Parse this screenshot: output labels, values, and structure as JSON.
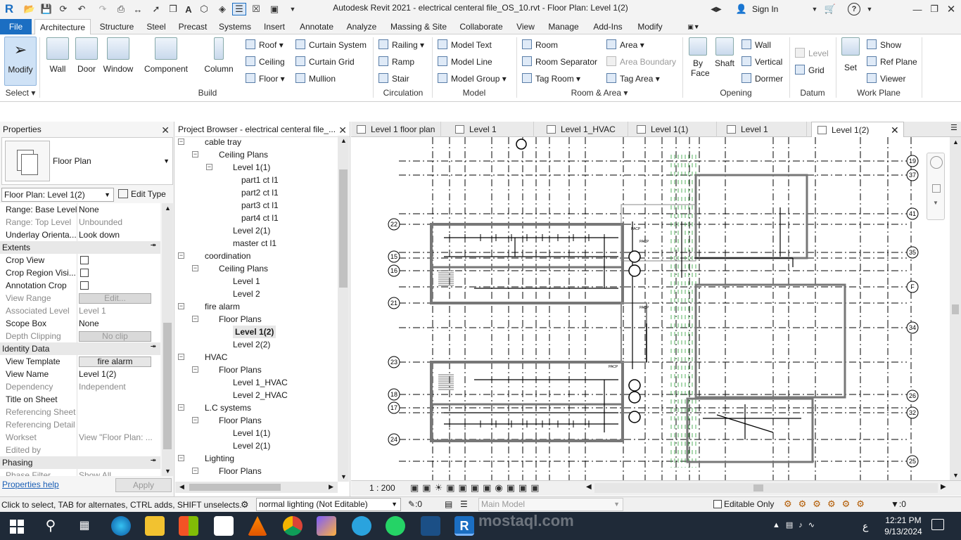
{
  "titlebar": {
    "title": "Autodesk Revit 2021 - electrical centeral file_OS_10.rvt - Floor Plan: Level 1(2)",
    "app_logo": "R",
    "sign_in": "Sign In",
    "help": "?"
  },
  "menu": {
    "tabs": [
      "File",
      "Architecture",
      "Structure",
      "Steel",
      "Precast",
      "Systems",
      "Insert",
      "Annotate",
      "Analyze",
      "Massing & Site",
      "Collaborate",
      "View",
      "Manage",
      "Add-Ins",
      "Modify"
    ],
    "active": "Architecture"
  },
  "ribbon": {
    "select": {
      "modify": "Modify",
      "panel": "Select"
    },
    "build": {
      "wall": "Wall",
      "door": "Door",
      "window": "Window",
      "component": "Component",
      "column": "Column",
      "roof": "Roof",
      "ceiling": "Ceiling",
      "floor": "Floor",
      "curtain_system": "Curtain System",
      "curtain_grid": "Curtain Grid",
      "mullion": "Mullion",
      "panel": "Build"
    },
    "circulation": {
      "railing": "Railing",
      "ramp": "Ramp",
      "stair": "Stair",
      "panel": "Circulation"
    },
    "model": {
      "model_text": "Model Text",
      "model_line": "Model Line",
      "model_group": "Model Group",
      "panel": "Model"
    },
    "room_area": {
      "room": "Room",
      "room_separator": "Room Separator",
      "tag_room": "Tag Room",
      "area": "Area",
      "area_boundary": "Area Boundary",
      "tag_area": "Tag Area",
      "panel": "Room & Area"
    },
    "opening": {
      "by_face": "By Face",
      "shaft": "Shaft",
      "wall": "Wall",
      "vertical": "Vertical",
      "dormer": "Dormer",
      "panel": "Opening"
    },
    "datum": {
      "level": "Level",
      "grid": "Grid",
      "panel": "Datum"
    },
    "work_plane": {
      "set": "Set",
      "show": "Show",
      "ref_plane": "Ref Plane",
      "viewer": "Viewer",
      "panel": "Work Plane"
    }
  },
  "properties": {
    "title": "Properties",
    "type_name": "Floor Plan",
    "instance_selector": "Floor Plan: Level 1(2)",
    "edit_type": "Edit Type",
    "rows": [
      {
        "k": "Range: Base Level",
        "v": "None",
        "grey": false
      },
      {
        "k": "Range: Top Level",
        "v": "Unbounded",
        "grey": true
      },
      {
        "k": "Underlay Orienta...",
        "v": "Look down",
        "grey": false
      },
      {
        "cat": "Extents"
      },
      {
        "k": "Crop View",
        "check": true
      },
      {
        "k": "Crop Region Visi...",
        "check": true
      },
      {
        "k": "Annotation Crop",
        "check": true
      },
      {
        "k": "View Range",
        "btn": "Edit...",
        "grey": true
      },
      {
        "k": "Associated Level",
        "v": "Level 1",
        "grey": true
      },
      {
        "k": "Scope Box",
        "v": "None",
        "grey": false
      },
      {
        "k": "Depth Clipping",
        "btn": "No clip",
        "grey": true
      },
      {
        "cat": "Identity Data"
      },
      {
        "k": "View Template",
        "btn": "fire alarm",
        "grey": false
      },
      {
        "k": "View Name",
        "v": "Level 1(2)",
        "grey": false
      },
      {
        "k": "Dependency",
        "v": "Independent",
        "grey": true
      },
      {
        "k": "Title on Sheet",
        "v": "",
        "grey": false
      },
      {
        "k": "Referencing Sheet",
        "v": "",
        "grey": true
      },
      {
        "k": "Referencing Detail",
        "v": "",
        "grey": true
      },
      {
        "k": "Workset",
        "v": "View \"Floor Plan: ...",
        "grey": true
      },
      {
        "k": "Edited by",
        "v": "",
        "grey": true
      },
      {
        "cat": "Phasing"
      },
      {
        "k": "Phase Filter",
        "v": "Show All",
        "grey": true
      }
    ],
    "help": "Properties help",
    "apply": "Apply"
  },
  "browser": {
    "title": "Project Browser - electrical centeral file_...",
    "nodes": [
      {
        "t": "cable tray",
        "lvl": 0,
        "exp": "-"
      },
      {
        "t": "Ceiling Plans",
        "lvl": 1,
        "exp": "-"
      },
      {
        "t": "Level 1(1)",
        "lvl": 2,
        "exp": "-"
      },
      {
        "t": "part1 ct l1",
        "lvl": 3
      },
      {
        "t": "part2 ct l1",
        "lvl": 3
      },
      {
        "t": "part3 ct l1",
        "lvl": 3
      },
      {
        "t": "part4 ct l1",
        "lvl": 3
      },
      {
        "t": "Level 2(1)",
        "lvl": 2
      },
      {
        "t": "master ct l1",
        "lvl": 2
      },
      {
        "t": "coordination",
        "lvl": 0,
        "exp": "-"
      },
      {
        "t": "Ceiling Plans",
        "lvl": 1,
        "exp": "-"
      },
      {
        "t": "Level 1",
        "lvl": 2
      },
      {
        "t": "Level 2",
        "lvl": 2
      },
      {
        "t": "fire alarm",
        "lvl": 0,
        "exp": "-"
      },
      {
        "t": "Floor Plans",
        "lvl": 1,
        "exp": "-"
      },
      {
        "t": "Level 1(2)",
        "lvl": 2,
        "bold": true
      },
      {
        "t": "Level 2(2)",
        "lvl": 2
      },
      {
        "t": "HVAC",
        "lvl": 0,
        "exp": "-"
      },
      {
        "t": "Floor Plans",
        "lvl": 1,
        "exp": "-"
      },
      {
        "t": "Level 1_HVAC",
        "lvl": 2
      },
      {
        "t": "Level 2_HVAC",
        "lvl": 2
      },
      {
        "t": "L.C systems",
        "lvl": 0,
        "exp": "-"
      },
      {
        "t": "Floor Plans",
        "lvl": 1,
        "exp": "-"
      },
      {
        "t": "Level 1(1)",
        "lvl": 2
      },
      {
        "t": "Level 2(1)",
        "lvl": 2
      },
      {
        "t": "Lighting",
        "lvl": 0,
        "exp": "-"
      },
      {
        "t": "Floor Plans",
        "lvl": 1,
        "exp": "-"
      }
    ]
  },
  "view_tabs": [
    {
      "label": "Level 1 floor plan"
    },
    {
      "label": "Level 1"
    },
    {
      "label": "Level 1_HVAC"
    },
    {
      "label": "Level 1(1)"
    },
    {
      "label": "Level 1"
    },
    {
      "label": "Level 1(2)",
      "active": true
    }
  ],
  "canvas": {
    "grid_bubbles_right": [
      "19",
      "37",
      "41",
      "35",
      "F",
      "34",
      "26",
      "32",
      "25"
    ],
    "grid_bubbles_left": [
      "22",
      "15",
      "16",
      "21",
      "23",
      "18",
      "17",
      "24"
    ],
    "panel_labels": [
      "PACP",
      "PACP",
      "PACP",
      "PACP"
    ]
  },
  "view_control": {
    "scale": "1 : 200"
  },
  "status": {
    "hint": "Click to select, TAB for alternates, CTRL adds, SHIFT unselects.",
    "lighting": "normal lighting (Not Editable)",
    "count": ":0",
    "model": "Main Model",
    "editable_only": "Editable Only",
    "filter": ":0"
  },
  "taskbar": {
    "time": "12:21 PM",
    "date": "9/13/2024",
    "lang": "ع",
    "watermark": "mostaql.com"
  },
  "colors": {
    "accent": "#1b6ec2",
    "taskbar": "#1f2a38",
    "grid_line": "#000000",
    "green_hatch": "#2e9e3a"
  }
}
